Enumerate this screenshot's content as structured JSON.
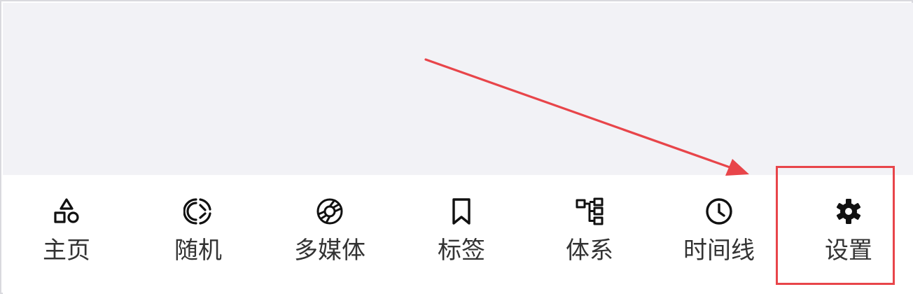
{
  "tabbar": {
    "items": [
      {
        "label": "主页",
        "icon": "shapes-icon"
      },
      {
        "label": "随机",
        "icon": "shuffle-disc-icon"
      },
      {
        "label": "多媒体",
        "icon": "aperture-icon"
      },
      {
        "label": "标签",
        "icon": "bookmark-icon"
      },
      {
        "label": "体系",
        "icon": "tree-structure-icon"
      },
      {
        "label": "时间线",
        "icon": "clock-icon"
      },
      {
        "label": "设置",
        "icon": "gear-icon"
      }
    ]
  },
  "annotation": {
    "color": "#e8454a",
    "target": "设置"
  },
  "colors": {
    "content_background": "#f2f2f6",
    "tabbar_background": "#ffffff",
    "icon": "#111111",
    "label": "#333333"
  }
}
